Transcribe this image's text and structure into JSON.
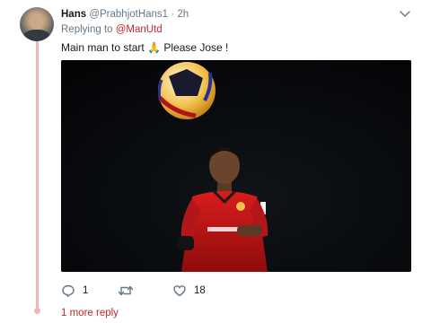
{
  "tweet": {
    "author_name": "Hans",
    "author_handle": "@PrabhjotHans1",
    "separator": "·",
    "timestamp": "2h",
    "replying_prefix": "Replying to",
    "replying_mention": "@ManUtd",
    "text_before_emoji": "Main man to start",
    "emoji": "🙏",
    "text_after_emoji": "Please Jose !",
    "media_kind": "photo"
  },
  "actions": {
    "reply_count": "1",
    "retweet_count": "",
    "like_count": "18"
  },
  "footer": {
    "more_reply_label": "1 more reply"
  },
  "colors": {
    "accent": "#c1272d",
    "muted": "#657786",
    "thread_line": "#e6b8b8",
    "media_background": "#050609"
  }
}
